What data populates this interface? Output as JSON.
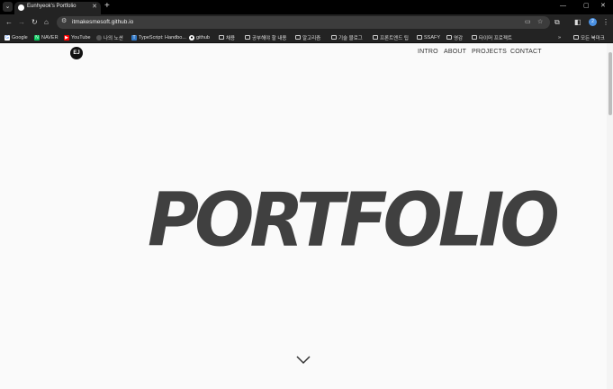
{
  "browser": {
    "tab_title": "Eunhyeok's Portfolio",
    "url": "itmakesmesoft.github.io",
    "profile_initial": "2",
    "bookmarks": [
      {
        "label": "Google",
        "icon": "google-icon",
        "color": "#ffffff"
      },
      {
        "label": "NAVER",
        "icon": "naver-icon",
        "color": "#03c75a"
      },
      {
        "label": "YouTube",
        "icon": "youtube-icon",
        "color": "#ff0000"
      },
      {
        "label": "나의 노션",
        "icon": "notion-icon",
        "color": "#dddddd"
      },
      {
        "label": "TypeScript: Handbo...",
        "icon": "typescript-icon",
        "color": "#3178c6"
      },
      {
        "label": "github",
        "icon": "github-icon",
        "color": "#ffffff"
      },
      {
        "label": "채용",
        "icon": "folder-icon"
      },
      {
        "label": "공부해야 할 내용",
        "icon": "folder-icon"
      },
      {
        "label": "알고리즘",
        "icon": "folder-icon"
      },
      {
        "label": "기술 블로그",
        "icon": "folder-icon"
      },
      {
        "label": "프론트엔드 팁",
        "icon": "folder-icon"
      },
      {
        "label": "SSAFY",
        "icon": "folder-icon"
      },
      {
        "label": "영감",
        "icon": "folder-icon"
      },
      {
        "label": "타이머 프로젝트",
        "icon": "folder-icon"
      }
    ],
    "all_bookmarks": "모든 북마크"
  },
  "site": {
    "logo_text": "EJ",
    "nav": [
      "INTRO",
      "ABOUT",
      "PROJECTS",
      "CONTACT"
    ],
    "hero_title": "PORTFOLIO"
  }
}
